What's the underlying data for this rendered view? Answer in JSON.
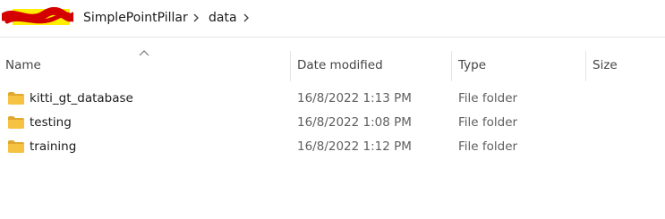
{
  "breadcrumb": {
    "items": [
      {
        "label": "SimplePointPillar"
      },
      {
        "label": "data"
      }
    ],
    "separator_icon": "chevron-right-icon",
    "trailing_icon": "chevron-right-icon"
  },
  "columns": [
    {
      "label": "Name",
      "sorted": "ascending"
    },
    {
      "label": "Date modified"
    },
    {
      "label": "Type"
    },
    {
      "label": "Size"
    }
  ],
  "rows": [
    {
      "name": "kitti_gt_database",
      "date": "16/8/2022 1:13 PM",
      "type": "File folder",
      "size": "",
      "icon": "folder-icon"
    },
    {
      "name": "testing",
      "date": "16/8/2022 1:08 PM",
      "type": "File folder",
      "size": "",
      "icon": "folder-icon"
    },
    {
      "name": "training",
      "date": "16/8/2022 1:12 PM",
      "type": "File folder",
      "size": "",
      "icon": "folder-icon"
    }
  ],
  "colors": {
    "folder": "#f5c242",
    "folder_dark": "#e0a82e",
    "redaction_red": "#d40000",
    "highlight_yellow": "#ffee00"
  }
}
